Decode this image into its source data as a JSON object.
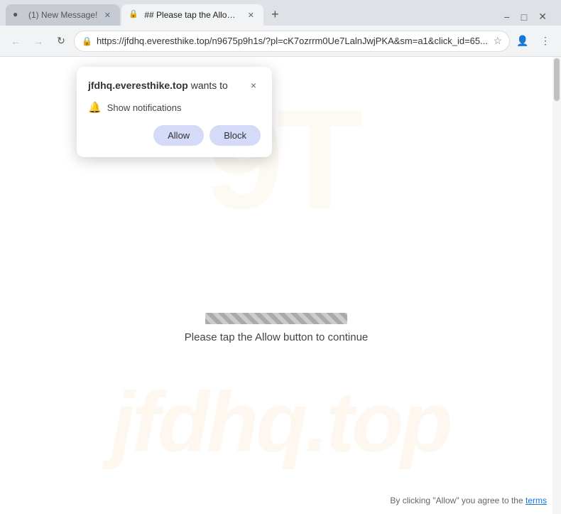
{
  "browser": {
    "tabs": [
      {
        "id": "tab1",
        "title": "(1) New Message!",
        "favicon": "●",
        "active": false
      },
      {
        "id": "tab2",
        "title": "## Please tap the Allow button...",
        "favicon": "🔒",
        "active": true
      }
    ],
    "new_tab_label": "+",
    "window_controls": {
      "minimize": "−",
      "maximize": "□",
      "close": "✕"
    },
    "nav": {
      "back": "←",
      "forward": "→",
      "reload": "↻",
      "address": "https://jfdhq.everesthike.top/n9675p9h1s/?pl=cK7ozrrm0Ue7LalnJwjPKA&sm=a1&click_id=65...",
      "star": "☆"
    },
    "toolbar_actions": {
      "profile_icon": "👤",
      "menu_icon": "⋮"
    }
  },
  "popup": {
    "domain": "jfdhq.everesthike.top",
    "wants_to": " wants to",
    "close_btn": "×",
    "notification_text": "Show notifications",
    "allow_label": "Allow",
    "block_label": "Block"
  },
  "page": {
    "watermark_top": "9T",
    "watermark_bottom": "jfdhq.top",
    "loading_text": "Please tap the Allow button to continue",
    "bottom_text": "By clicking \"Allow\" you agree to the",
    "terms_link": "terms"
  }
}
